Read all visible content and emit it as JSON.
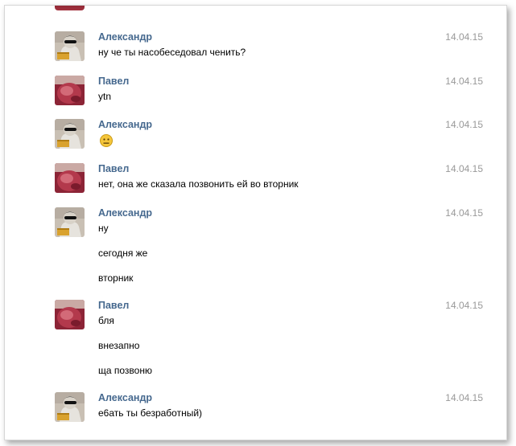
{
  "messages": [
    {
      "author": "Александр",
      "avatar": "alexander-avatar",
      "date": "14.04.15",
      "lines": [
        "ну че ты насобеседовал ченить?"
      ]
    },
    {
      "author": "Павел",
      "avatar": "pavel-avatar",
      "date": "14.04.15",
      "lines": [
        "ytn"
      ]
    },
    {
      "author": "Александр",
      "avatar": "alexander-avatar",
      "date": "14.04.15",
      "emoji": "neutral-face-emoji"
    },
    {
      "author": "Павел",
      "avatar": "pavel-avatar",
      "date": "14.04.15",
      "lines": [
        "нет, она же сказала позвонить ей во вторник"
      ]
    },
    {
      "author": "Александр",
      "avatar": "alexander-avatar",
      "date": "14.04.15",
      "lines": [
        "ну",
        "сегодня же",
        "вторник"
      ]
    },
    {
      "author": "Павел",
      "avatar": "pavel-avatar",
      "date": "14.04.15",
      "lines": [
        "бля",
        "внезапно",
        "ща позвоню"
      ]
    },
    {
      "author": "Александр",
      "avatar": "alexander-avatar",
      "date": "14.04.15",
      "lines": [
        "е6ать ты безработный)"
      ]
    }
  ],
  "colors": {
    "author_name": "#45688e",
    "date": "#999999",
    "text": "#000000",
    "emoji_fill": "#f5c63b"
  }
}
